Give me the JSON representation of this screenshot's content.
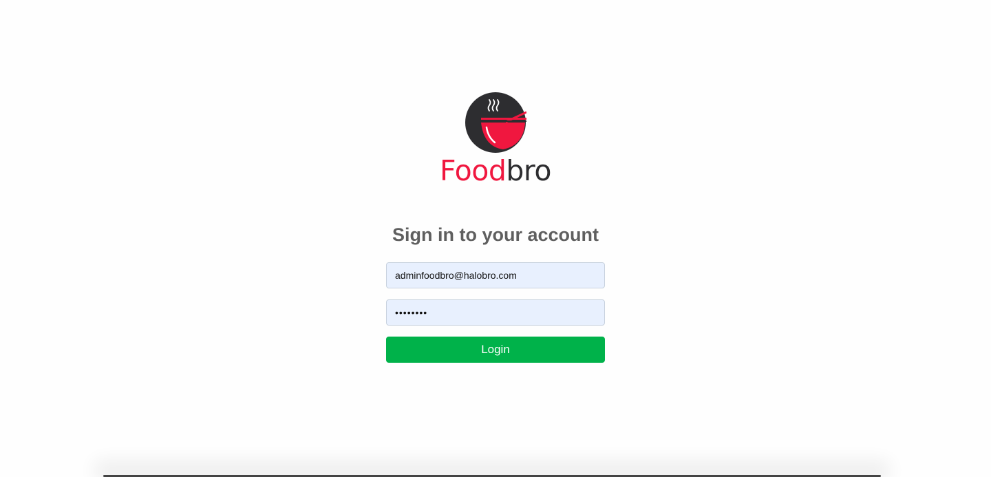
{
  "brand": {
    "name_part1": "Food",
    "name_part2": "bro",
    "logo_icon": "steaming-bowl-icon",
    "colors": {
      "primary_red": "#f0173f",
      "dark": "#2d2d30"
    }
  },
  "login": {
    "title": "Sign in to your account",
    "email_value": "adminfoodbro@halobro.com",
    "password_value": "••••••••",
    "button_label": "Login",
    "button_color": "#00b24a",
    "input_background": "#e8f0fe"
  }
}
